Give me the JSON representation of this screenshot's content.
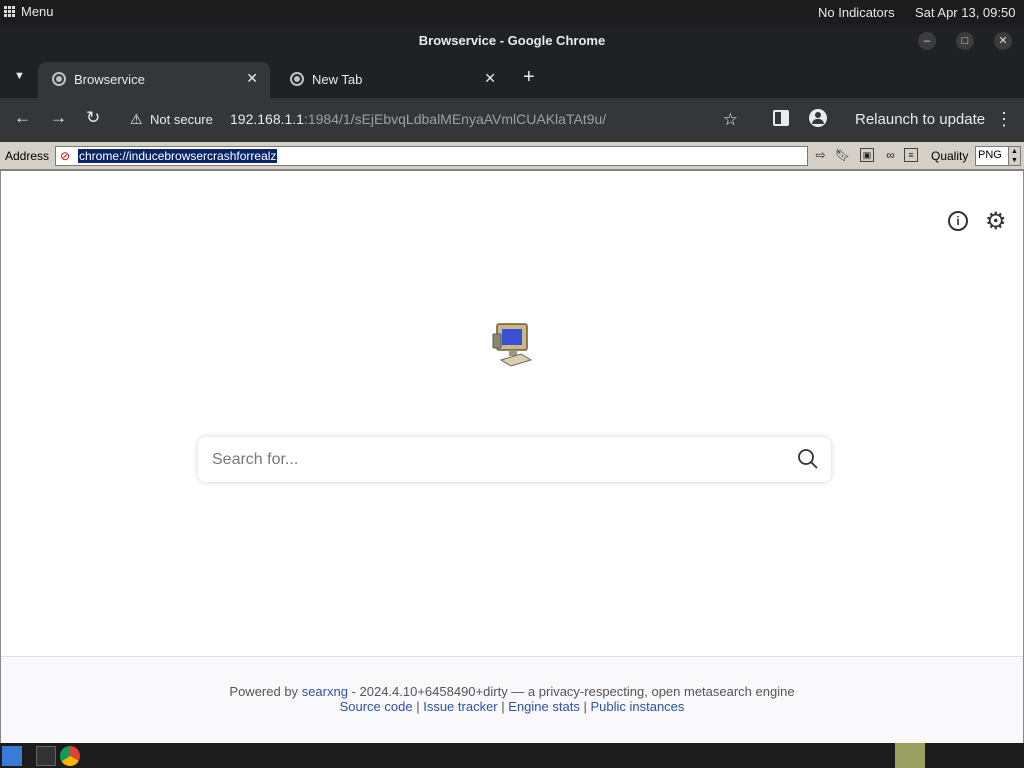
{
  "system_bar": {
    "menu_label": "Menu",
    "indicators": "No Indicators",
    "datetime": "Sat Apr 13, 09:50"
  },
  "window": {
    "title": "Browservice - Google Chrome"
  },
  "tabs": [
    {
      "label": "Browservice",
      "active": true
    },
    {
      "label": "New Tab",
      "active": false
    }
  ],
  "toolbar": {
    "security_label": "Not secure",
    "url_host": "192.168.1.1",
    "url_rest": ":1984/1/sEjEbvqLdbalMEnyaAVmlCUAKlaTAt9u/",
    "relaunch_label": "Relaunch to update"
  },
  "browservice_bar": {
    "address_label": "Address",
    "address_value": "chrome://inducebrowsercrashforrealz",
    "quality_label": "Quality",
    "quality_value": "PNG"
  },
  "search": {
    "placeholder": "Search for..."
  },
  "footer": {
    "powered_by": "Powered by",
    "searxng_link": "searxng",
    "version_text": "- 2024.4.10+6458490+dirty — a privacy-respecting, open metasearch engine",
    "links": [
      "Source code",
      "Issue tracker",
      "Engine stats",
      "Public instances"
    ],
    "separator": "|"
  },
  "colors": {
    "chrome_dark": "#202124",
    "chrome_toolbar": "#35363a",
    "link_blue": "#3050a0",
    "selection_blue": "#0a246a"
  }
}
